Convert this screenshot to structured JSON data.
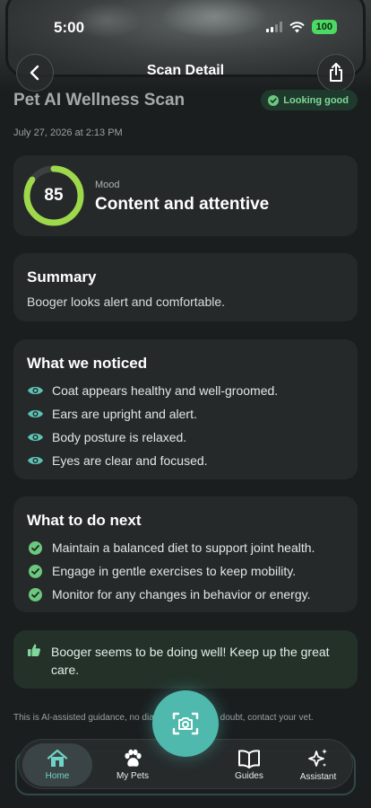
{
  "status_bar": {
    "time": "5:00",
    "battery": "100"
  },
  "nav": {
    "title": "Scan Detail",
    "back_icon": "chevron-left-icon",
    "share_icon": "share-icon"
  },
  "scan": {
    "title": "Pet AI Wellness Scan",
    "status_label": "Looking good",
    "date": "July 27, 2026 at 2:13 PM"
  },
  "mood": {
    "score": "85",
    "score_fraction": 0.85,
    "label": "Mood",
    "value": "Content and attentive",
    "ring_color": "#9ed84b"
  },
  "summary": {
    "heading": "Summary",
    "text": "Booger looks alert and comfortable."
  },
  "noticed": {
    "heading": "What we noticed",
    "icon": "eye-icon",
    "items": [
      "Coat appears healthy and well-groomed.",
      "Ears are upright and alert.",
      "Body posture is relaxed.",
      "Eyes are clear and focused."
    ]
  },
  "next_steps": {
    "heading": "What to do next",
    "icon": "check-circle-icon",
    "items": [
      "Maintain a balanced diet to support joint health.",
      "Engage in gentle exercises to keep mobility.",
      "Monitor for any changes in behavior or energy."
    ]
  },
  "encouragement": {
    "icon": "thumbs-up-icon",
    "text": "Booger seems to be doing well! Keep up the great care."
  },
  "disclaimer": {
    "text": "This is AI-assisted guidance, no        diagnosis. When in doubt, contact your vet."
  },
  "tabbar": {
    "home": "Home",
    "pets": "My Pets",
    "guides": "Guides",
    "assistant": "Assistant"
  },
  "fab": {
    "icon": "camera-scan-icon"
  },
  "colors": {
    "accent": "#4fb9ad",
    "success": "#7fd79a",
    "eye": "#5cc3b5",
    "check": "#6cc77f"
  }
}
